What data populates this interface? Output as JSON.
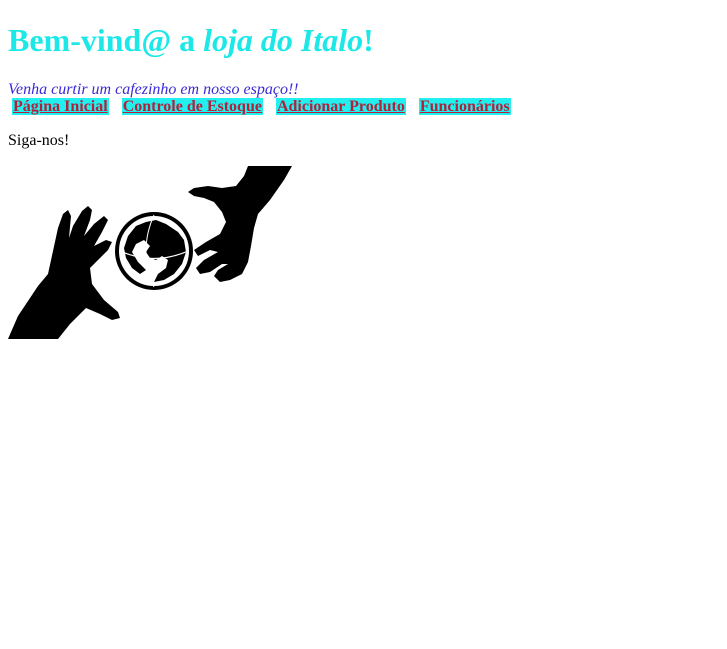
{
  "header": {
    "title_prefix": "Bem-vind@ a ",
    "title_emphasis": "loja do Italo",
    "title_suffix": "!",
    "title_color": "#1ce8e8"
  },
  "tagline": "Venha curtir um cafezinho em nosso espaço!!",
  "nav": {
    "items": [
      {
        "label": "Página Inicial"
      },
      {
        "label": "Controle de Estoque"
      },
      {
        "label": "Adicionar Produto"
      },
      {
        "label": "Funcionários"
      }
    ],
    "background": "#22f0f0",
    "link_color": "#b2203a"
  },
  "social": {
    "label": "Siga-nos!",
    "logo_icon": "hands-holding-globe-icon"
  }
}
